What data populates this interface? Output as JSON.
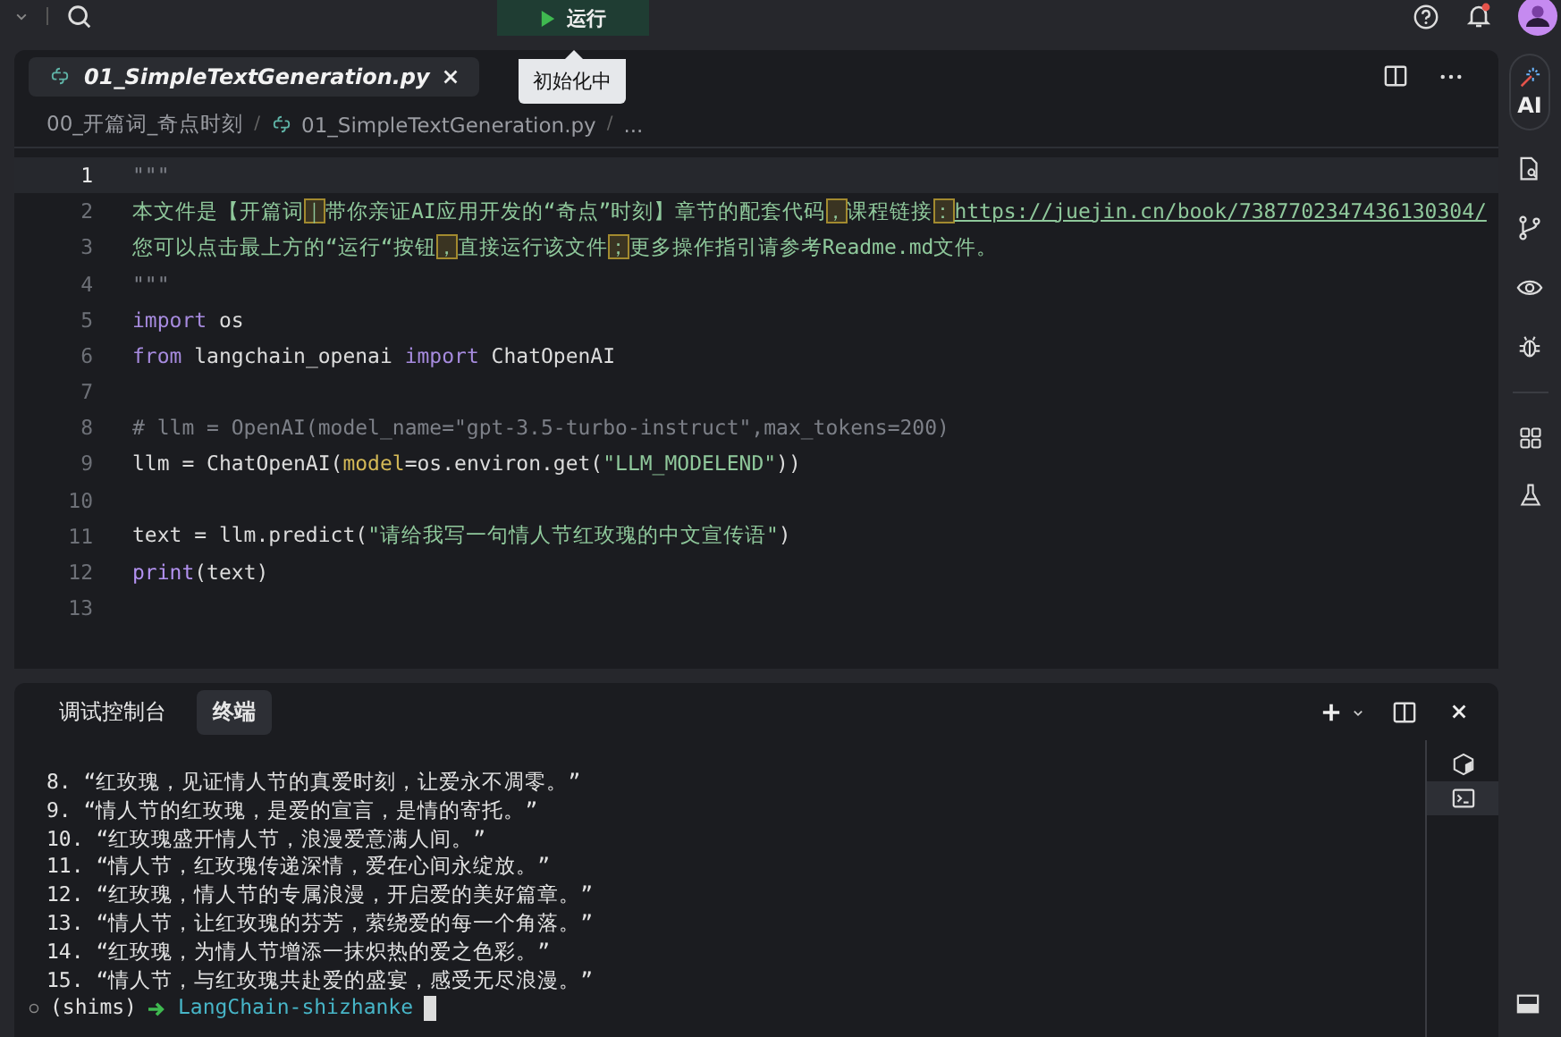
{
  "topbar": {
    "run_button": "运行",
    "tooltip": "初始化中",
    "notification_dot": true
  },
  "editor": {
    "tabs": [
      {
        "label": "01_SimpleTextGeneration.py",
        "selected": true
      }
    ],
    "breadcrumb": [
      {
        "kind": "folder",
        "label": "00_开篇词_奇点时刻"
      },
      {
        "kind": "sep",
        "label": "/"
      },
      {
        "kind": "file",
        "label": "01_SimpleTextGeneration.py"
      },
      {
        "kind": "sep",
        "label": "/"
      },
      {
        "kind": "more",
        "label": "..."
      }
    ],
    "lines": [
      {
        "number": "1",
        "current": true,
        "tokens": [
          {
            "kind": "comment",
            "text": "\"\"\""
          }
        ]
      },
      {
        "number": "2",
        "current": false,
        "tokens": [
          {
            "kind": "string",
            "text": "本文件是【开篇词"
          },
          {
            "kind": "flag",
            "text": "｜"
          },
          {
            "kind": "string",
            "text": "带你亲证AI应用开发的“奇点”时刻】章节的配套代码"
          },
          {
            "kind": "flag",
            "text": "，"
          },
          {
            "kind": "string",
            "text": "课程链接"
          },
          {
            "kind": "flag",
            "text": "："
          },
          {
            "kind": "link",
            "text": "https://juejin.cn/book/7387702347436130304/"
          }
        ]
      },
      {
        "number": "3",
        "current": false,
        "tokens": [
          {
            "kind": "string",
            "text": "您可以点击最上方的“运行“按钮"
          },
          {
            "kind": "flag",
            "text": "，"
          },
          {
            "kind": "string",
            "text": "直接运行该文件"
          },
          {
            "kind": "flag",
            "text": "；"
          },
          {
            "kind": "string",
            "text": "更多操作指引请参考Readme.md文件。"
          }
        ]
      },
      {
        "number": "4",
        "current": false,
        "tokens": [
          {
            "kind": "comment",
            "text": "\"\"\""
          }
        ]
      },
      {
        "number": "5",
        "current": false,
        "tokens": [
          {
            "kind": "keyword",
            "text": "import"
          },
          {
            "kind": "plain",
            "text": " os"
          }
        ]
      },
      {
        "number": "6",
        "current": false,
        "tokens": [
          {
            "kind": "keyword",
            "text": "from"
          },
          {
            "kind": "plain",
            "text": " langchain_openai "
          },
          {
            "kind": "keyword",
            "text": "import"
          },
          {
            "kind": "plain",
            "text": " ChatOpenAI"
          }
        ]
      },
      {
        "number": "7",
        "current": false
      },
      {
        "number": "8",
        "current": false,
        "tokens": [
          {
            "kind": "comment",
            "text": "# llm = OpenAI(model_name=\"gpt-3.5-turbo-instruct\",max_tokens=200)"
          }
        ]
      },
      {
        "number": "9",
        "current": false,
        "tokens": [
          {
            "kind": "plain",
            "text": "llm = ChatOpenAI("
          },
          {
            "kind": "param",
            "text": "model"
          },
          {
            "kind": "plain",
            "text": "=os.environ.get("
          },
          {
            "kind": "string",
            "text": "\"LLM_MODELEND\""
          },
          {
            "kind": "plain",
            "text": "))"
          }
        ]
      },
      {
        "number": "10",
        "current": false
      },
      {
        "number": "11",
        "current": false,
        "tokens": [
          {
            "kind": "plain",
            "text": "text = llm.predict("
          },
          {
            "kind": "string",
            "text": "\"请给我写一句情人节红玫瑰的中文宣传语\""
          },
          {
            "kind": "plain",
            "text": ")"
          }
        ]
      },
      {
        "number": "12",
        "current": false,
        "tokens": [
          {
            "kind": "func",
            "text": "print"
          },
          {
            "kind": "plain",
            "text": "(text)"
          }
        ]
      },
      {
        "number": "13",
        "current": false
      }
    ]
  },
  "panel": {
    "tabs": [
      {
        "label": "调试控制台",
        "selected": false
      },
      {
        "label": "终端",
        "selected": true
      }
    ],
    "output": [
      "8. “红玫瑰，见证情人节的真爱时刻，让爱永不凋零。”",
      "9. “情人节的红玫瑰，是爱的宣言，是情的寄托。”",
      "10. “红玫瑰盛开情人节，浪漫爱意满人间。”",
      "11. “情人节，红玫瑰传递深情，爱在心间永绽放。”",
      "12. “红玫瑰，情人节的专属浪漫，开启爱的美好篇章。”",
      "13. “情人节，让红玫瑰的芬芳，萦绕爱的每一个角落。”",
      "14. “红玫瑰，为情人节增添一抹炽热的爱之色彩。”",
      "15. “情人节，与红玫瑰共赴爱的盛宴，感受无尽浪漫。”"
    ],
    "prompt": {
      "env": "(shims)",
      "directory": "LangChain-shizhanke"
    },
    "side_tabs": [
      {
        "kind": "cube",
        "selected": false
      },
      {
        "kind": "terminal",
        "selected": true
      }
    ]
  },
  "activity_bar": {
    "ai_label": "AI"
  }
}
